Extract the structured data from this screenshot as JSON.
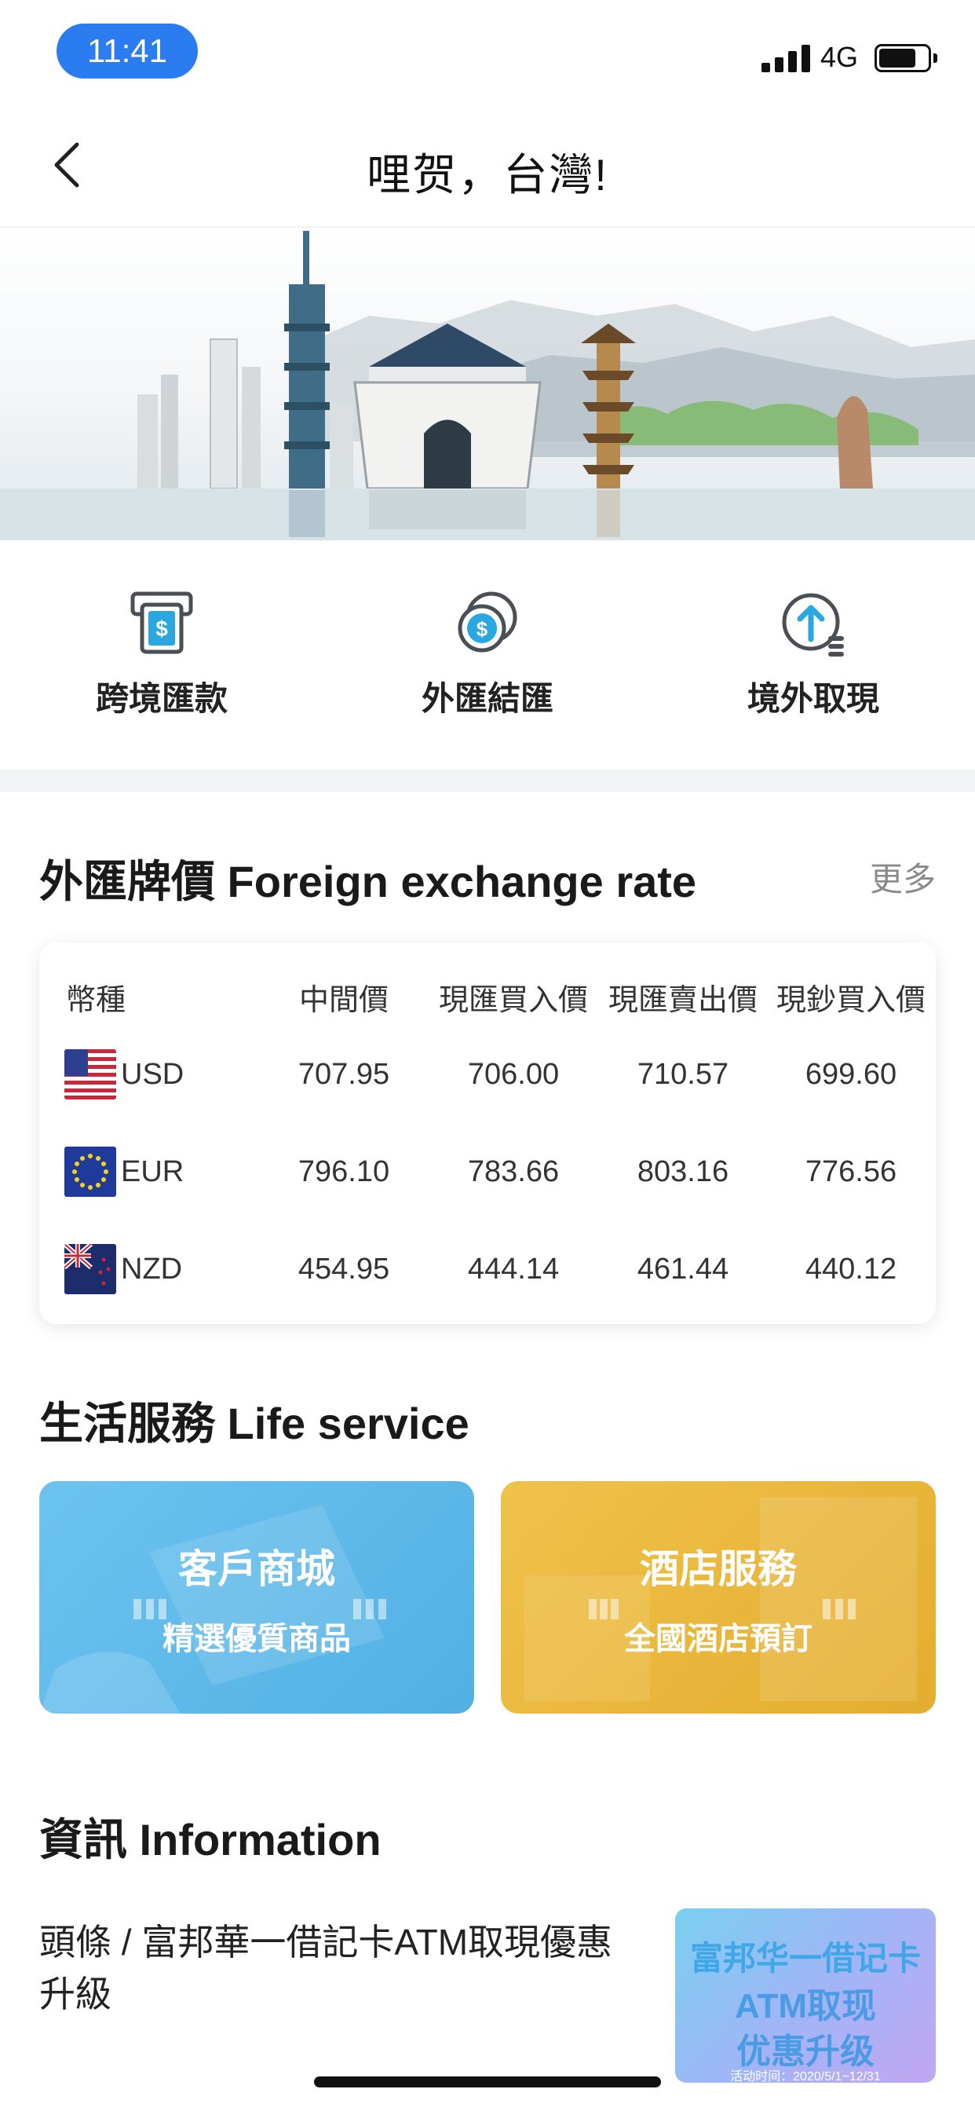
{
  "status_bar": {
    "time": "11:41",
    "network": "4G"
  },
  "nav": {
    "title": "哩贺，台灣!"
  },
  "quick_actions": [
    {
      "label": "跨境匯款",
      "icon": "atm-dollar-icon"
    },
    {
      "label": "外匯結匯",
      "icon": "coin-exchange-icon"
    },
    {
      "label": "境外取現",
      "icon": "upload-cash-icon"
    }
  ],
  "fx": {
    "title": "外匯牌價 Foreign exchange rate",
    "more": "更多",
    "headers": [
      "幣種",
      "中間價",
      "現匯買入價",
      "現匯賣出價",
      "現鈔買入價"
    ],
    "rows": [
      {
        "currency": "USD",
        "flag": "us-flag-icon",
        "mid": "707.95",
        "tt_buy": "706.00",
        "tt_sell": "710.57",
        "cash_buy": "699.60"
      },
      {
        "currency": "EUR",
        "flag": "eu-flag-icon",
        "mid": "796.10",
        "tt_buy": "783.66",
        "tt_sell": "803.16",
        "cash_buy": "776.56"
      },
      {
        "currency": "NZD",
        "flag": "nz-flag-icon",
        "mid": "454.95",
        "tt_buy": "444.14",
        "tt_sell": "461.44",
        "cash_buy": "440.12"
      }
    ]
  },
  "life": {
    "title": "生活服務 Life service",
    "cards": [
      {
        "title": "客戶商城",
        "subtitle": "精選優質商品",
        "color": "#5cb8e8"
      },
      {
        "title": "酒店服務",
        "subtitle": "全國酒店預訂",
        "color": "#e8b53a"
      }
    ]
  },
  "info": {
    "title": "資訊 Information",
    "headline": "頭條 / 富邦華一借記卡ATM取現優惠升級",
    "thumb": {
      "line1": "富邦华一借记卡",
      "line2": "ATM取现",
      "line3": "优惠升级",
      "line4": "活动时间：2020/5/1~12/31"
    }
  },
  "colors": {
    "accent": "#2a7cf0",
    "icon_blue": "#2aa6e0"
  }
}
